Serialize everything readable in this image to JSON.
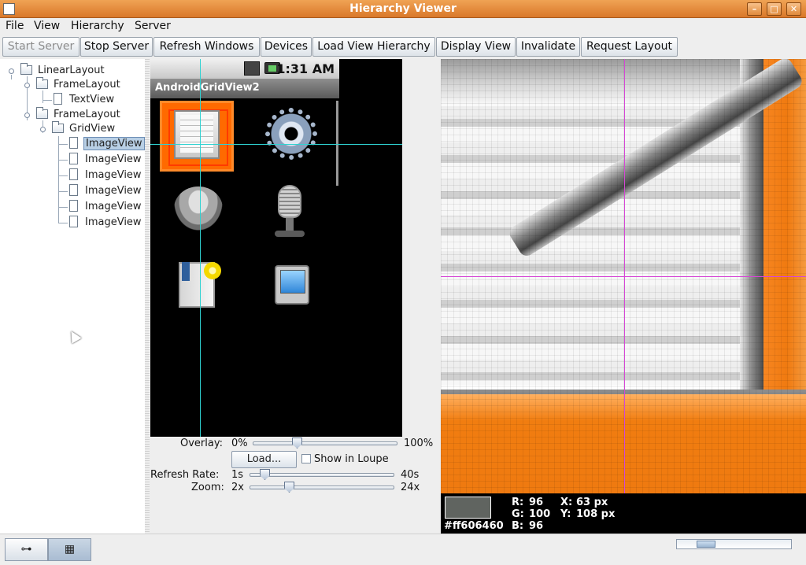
{
  "window": {
    "title": "Hierarchy Viewer",
    "controls": {
      "minimize": "–",
      "maximize": "□",
      "close": "✕"
    }
  },
  "menu": [
    "File",
    "View",
    "Hierarchy",
    "Server"
  ],
  "toolbar": {
    "start_server": "Start Server",
    "stop_server": "Stop Server",
    "refresh_windows": "Refresh Windows",
    "devices": "Devices",
    "load_view_hierarchy": "Load View Hierarchy",
    "display_view": "Display View",
    "invalidate": "Invalidate",
    "request_layout": "Request Layout"
  },
  "tree": [
    {
      "label": "LinearLayout",
      "type": "folder",
      "depth": 0,
      "expanded": true
    },
    {
      "label": "FrameLayout",
      "type": "folder",
      "depth": 1,
      "expanded": true
    },
    {
      "label": "TextView",
      "type": "leaf",
      "depth": 2
    },
    {
      "label": "FrameLayout",
      "type": "folder",
      "depth": 1,
      "expanded": true
    },
    {
      "label": "GridView",
      "type": "folder",
      "depth": 2,
      "expanded": true
    },
    {
      "label": "ImageView",
      "type": "leaf",
      "depth": 3,
      "selected": true
    },
    {
      "label": "ImageView",
      "type": "leaf",
      "depth": 3
    },
    {
      "label": "ImageView",
      "type": "leaf",
      "depth": 3
    },
    {
      "label": "ImageView",
      "type": "leaf",
      "depth": 3
    },
    {
      "label": "ImageView",
      "type": "leaf",
      "depth": 3
    },
    {
      "label": "ImageView",
      "type": "leaf",
      "depth": 3
    }
  ],
  "device": {
    "time": "1:31 AM",
    "app_title": "AndroidGridView2",
    "grid_icons": [
      "notepad-icon",
      "gear-icon",
      "speaker-icon",
      "microphone-icon",
      "book-bulb-icon",
      "tablet-icon"
    ]
  },
  "controls": {
    "overlay_label": "Overlay:",
    "overlay_min": "0%",
    "overlay_max": "100%",
    "load_button": "Load...",
    "show_in_loupe": "Show in Loupe",
    "show_in_loupe_checked": false,
    "refresh_label": "Refresh Rate:",
    "refresh_min": "1s",
    "refresh_max": "40s",
    "zoom_label": "Zoom:",
    "zoom_min": "2x",
    "zoom_max": "24x"
  },
  "pixel": {
    "hex": "#ff606460",
    "swatch_color": "#606460",
    "r_label": "R:",
    "r": "96",
    "g_label": "G:",
    "g": "100",
    "b_label": "B:",
    "b": "96",
    "x_label": "X:",
    "x": "63 px",
    "y_label": "Y:",
    "y": "108 px"
  },
  "mode_buttons": [
    "tree-view-icon",
    "pixel-perfect-icon"
  ],
  "colors": {
    "title_bar": "#e08a3c",
    "crosshair_device": "#2fd2d2",
    "crosshair_loupe": "#d646d6",
    "selection": "#b8cfe5",
    "focus_orange": "#ff6a00"
  }
}
